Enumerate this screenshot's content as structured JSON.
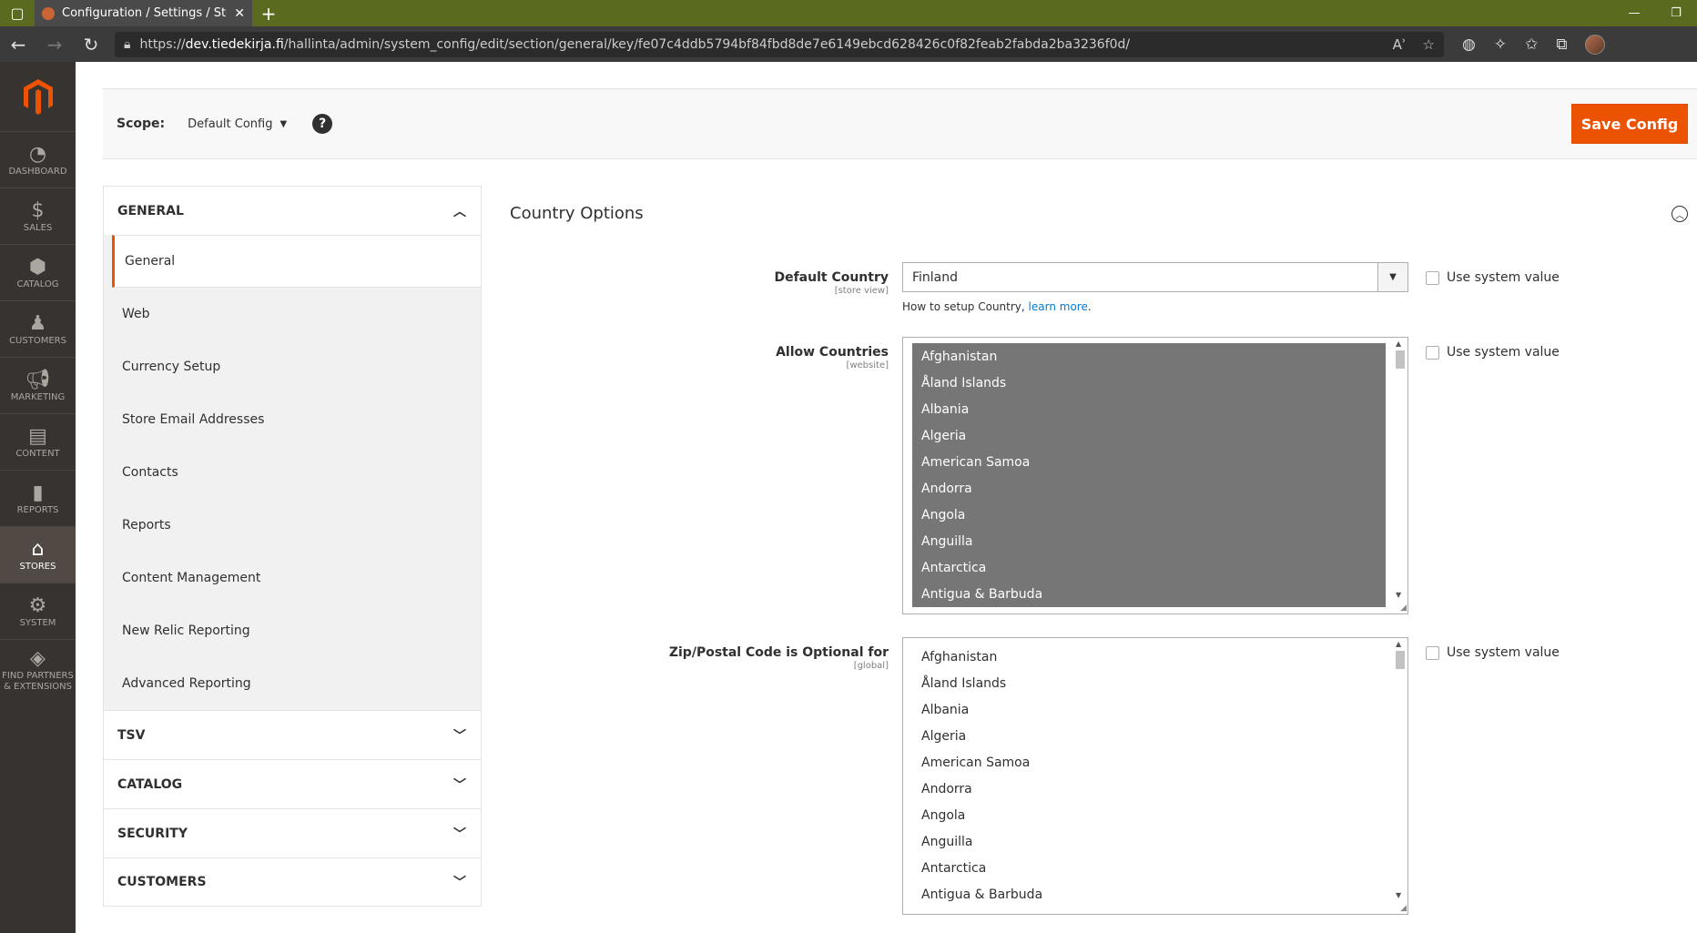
{
  "browser": {
    "tab_title": "Configuration / Settings / Stores",
    "url_prefix": "https://",
    "url_host": "dev.tiedekirja.fi",
    "url_path": "/hallinta/admin/system_config/edit/section/general/key/fe07c4ddb5794bf84fbd8de7e6149ebcd628426c0f82feab2fabda2ba3236f0d/",
    "read_aloud_label": "Aʾ"
  },
  "admin_menu": {
    "items": [
      {
        "label": "DASHBOARD",
        "icon": "dashboard-icon"
      },
      {
        "label": "SALES",
        "icon": "dollar-icon"
      },
      {
        "label": "CATALOG",
        "icon": "box-icon"
      },
      {
        "label": "CUSTOMERS",
        "icon": "person-icon"
      },
      {
        "label": "MARKETING",
        "icon": "megaphone-icon"
      },
      {
        "label": "CONTENT",
        "icon": "layout-icon"
      },
      {
        "label": "REPORTS",
        "icon": "bar-chart-icon"
      },
      {
        "label": "STORES",
        "icon": "store-icon"
      },
      {
        "label": "SYSTEM",
        "icon": "gear-icon"
      },
      {
        "label": "FIND PARTNERS & EXTENSIONS",
        "icon": "cube-icon"
      }
    ],
    "active": "STORES"
  },
  "header": {
    "scope_label": "Scope:",
    "scope_value": "Default Config",
    "help": "?",
    "save_label": "Save Config"
  },
  "config_tabs": {
    "general_title": "GENERAL",
    "general_items": [
      "General",
      "Web",
      "Currency Setup",
      "Store Email Addresses",
      "Contacts",
      "Reports",
      "Content Management",
      "New Relic Reporting",
      "Advanced Reporting"
    ],
    "active_item": "General",
    "other_sections": [
      "TSV",
      "CATALOG",
      "SECURITY",
      "CUSTOMERS"
    ]
  },
  "country_options": {
    "title": "Country Options",
    "default_country": {
      "label": "Default Country",
      "scope": "[store view]",
      "value": "Finland",
      "note_prefix": "How to setup Country, ",
      "note_link": "learn more",
      "note_suffix": ".",
      "use_system": "Use system value"
    },
    "allow_countries": {
      "label": "Allow Countries",
      "scope": "[website]",
      "use_system": "Use system value"
    },
    "zip_optional": {
      "label": "Zip/Postal Code is Optional for",
      "scope": "[global]",
      "use_system": "Use system value"
    },
    "countries": [
      "Afghanistan",
      "Åland Islands",
      "Albania",
      "Algeria",
      "American Samoa",
      "Andorra",
      "Angola",
      "Anguilla",
      "Antarctica",
      "Antigua & Barbuda"
    ]
  },
  "colors": {
    "accent": "#eb5202",
    "menu_bg": "#373330",
    "selected_bg": "#767676"
  }
}
